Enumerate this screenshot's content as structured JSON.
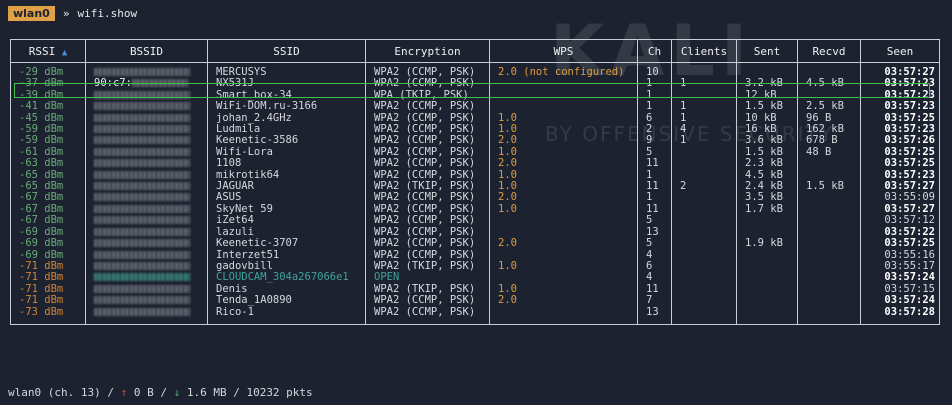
{
  "header": {
    "interface_tag": "wlan0",
    "prompt_symbol": "»",
    "command": "wifi.show"
  },
  "watermark": {
    "logo_text": "KALI",
    "subtitle": "BY OFFENSIVE SECURITY"
  },
  "columns": {
    "rssi": "RSSI",
    "bssid": "BSSID",
    "ssid": "SSID",
    "encryption": "Encryption",
    "wps": "WPS",
    "ch": "Ch",
    "clients": "Clients",
    "sent": "Sent",
    "recvd": "Recvd",
    "seen": "Seen"
  },
  "colors": {
    "background": "#1c2230",
    "rssi_good": "#6aaa78",
    "rssi_weak": "#d1843a",
    "wps_value": "#e09a3e",
    "open_network": "#3fa39a",
    "selection_outline": "#3fc24d",
    "interface_tag_bg": "#e0a047"
  },
  "rows": [
    {
      "rssi": "-29 dBm",
      "rssi_level": "good",
      "bssid_visible": "",
      "ssid": "MERCUSYS",
      "encryption": "WPA2 (CCMP, PSK)",
      "wps": "2.0 (not configured)",
      "ch": "10",
      "clients": "",
      "sent": "",
      "recvd": "",
      "seen": "03:57:27",
      "seen_bold": true
    },
    {
      "rssi": "-37 dBm",
      "rssi_level": "good",
      "bssid_visible": "90:c7:",
      "ssid": "NX531J",
      "encryption": "WPA2 (CCMP, PSK)",
      "wps": "",
      "ch": "1",
      "clients": "1",
      "sent": "3.2 kB",
      "recvd": "4.5 kB",
      "seen": "03:57:23",
      "seen_bold": true,
      "selected": true
    },
    {
      "rssi": "-39 dBm",
      "rssi_level": "good",
      "bssid_visible": "",
      "ssid": "Smart_box-34",
      "encryption": "WPA (TKIP, PSK)",
      "wps": "",
      "ch": "1",
      "clients": "",
      "sent": "12 kB",
      "recvd": "",
      "seen": "03:57:23",
      "seen_bold": true
    },
    {
      "rssi": "-41 dBm",
      "rssi_level": "good",
      "bssid_visible": "",
      "ssid": "WiFi-DOM.ru-3166",
      "encryption": "WPA2 (CCMP, PSK)",
      "wps": "",
      "ch": "1",
      "clients": "1",
      "sent": "1.5 kB",
      "recvd": "2.5 kB",
      "seen": "03:57:23",
      "seen_bold": true
    },
    {
      "rssi": "-45 dBm",
      "rssi_level": "good",
      "bssid_visible": "",
      "ssid": "johan_2.4GHz",
      "encryption": "WPA2 (CCMP, PSK)",
      "wps": "1.0",
      "ch": "6",
      "clients": "1",
      "sent": "10 kB",
      "recvd": "96 B",
      "seen": "03:57:25",
      "seen_bold": true
    },
    {
      "rssi": "-59 dBm",
      "rssi_level": "good",
      "bssid_visible": "",
      "ssid": "Ludmila",
      "encryption": "WPA2 (CCMP, PSK)",
      "wps": "1.0",
      "ch": "2",
      "clients": "4",
      "sent": "16 kB",
      "recvd": "162 kB",
      "seen": "03:57:23",
      "seen_bold": true
    },
    {
      "rssi": "-59 dBm",
      "rssi_level": "good",
      "bssid_visible": "",
      "ssid": "Keenetic-3586",
      "encryption": "WPA2 (CCMP, PSK)",
      "wps": "2.0",
      "ch": "9",
      "clients": "1",
      "sent": "3.6 kB",
      "recvd": "678 B",
      "seen": "03:57:26",
      "seen_bold": true
    },
    {
      "rssi": "-61 dBm",
      "rssi_level": "good",
      "bssid_visible": "",
      "ssid": "Wifi-Lora",
      "encryption": "WPA2 (CCMP, PSK)",
      "wps": "1.0",
      "ch": "5",
      "clients": "",
      "sent": "1.5 kB",
      "recvd": "48 B",
      "seen": "03:57:25",
      "seen_bold": true
    },
    {
      "rssi": "-63 dBm",
      "rssi_level": "good",
      "bssid_visible": "",
      "ssid": "1108",
      "encryption": "WPA2 (CCMP, PSK)",
      "wps": "2.0",
      "ch": "11",
      "clients": "",
      "sent": "2.3 kB",
      "recvd": "",
      "seen": "03:57:25",
      "seen_bold": true
    },
    {
      "rssi": "-65 dBm",
      "rssi_level": "good",
      "bssid_visible": "",
      "ssid": "mikrotik64",
      "encryption": "WPA2 (CCMP, PSK)",
      "wps": "1.0",
      "ch": "1",
      "clients": "",
      "sent": "4.5 kB",
      "recvd": "",
      "seen": "03:57:23",
      "seen_bold": true
    },
    {
      "rssi": "-65 dBm",
      "rssi_level": "good",
      "bssid_visible": "",
      "ssid": "JAGUAR",
      "encryption": "WPA2 (TKIP, PSK)",
      "wps": "1.0",
      "ch": "11",
      "clients": "2",
      "sent": "2.4 kB",
      "recvd": "1.5 kB",
      "seen": "03:57:27",
      "seen_bold": true
    },
    {
      "rssi": "-67 dBm",
      "rssi_level": "good",
      "bssid_visible": "",
      "ssid": "ASUS",
      "encryption": "WPA2 (CCMP, PSK)",
      "wps": "2.0",
      "ch": "1",
      "clients": "",
      "sent": "3.5 kB",
      "recvd": "",
      "seen": "03:55:09",
      "seen_bold": false
    },
    {
      "rssi": "-67 dBm",
      "rssi_level": "good",
      "bssid_visible": "",
      "ssid": "SkyNet 59",
      "encryption": "WPA2 (CCMP, PSK)",
      "wps": "1.0",
      "ch": "11",
      "clients": "",
      "sent": "1.7 kB",
      "recvd": "",
      "seen": "03:57:27",
      "seen_bold": true
    },
    {
      "rssi": "-67 dBm",
      "rssi_level": "good",
      "bssid_visible": "",
      "ssid": "iZet64",
      "encryption": "WPA2 (CCMP, PSK)",
      "wps": "",
      "ch": "5",
      "clients": "",
      "sent": "",
      "recvd": "",
      "seen": "03:57:12",
      "seen_bold": false
    },
    {
      "rssi": "-69 dBm",
      "rssi_level": "good",
      "bssid_visible": "",
      "ssid": "lazuli",
      "encryption": "WPA2 (CCMP, PSK)",
      "wps": "",
      "ch": "13",
      "clients": "",
      "sent": "",
      "recvd": "",
      "seen": "03:57:22",
      "seen_bold": true
    },
    {
      "rssi": "-69 dBm",
      "rssi_level": "good",
      "bssid_visible": "",
      "ssid": "Keenetic-3707",
      "encryption": "WPA2 (CCMP, PSK)",
      "wps": "2.0",
      "ch": "5",
      "clients": "",
      "sent": "1.9 kB",
      "recvd": "",
      "seen": "03:57:25",
      "seen_bold": true
    },
    {
      "rssi": "-69 dBm",
      "rssi_level": "good",
      "bssid_visible": "",
      "ssid": "Interzet51",
      "encryption": "WPA2 (CCMP, PSK)",
      "wps": "",
      "ch": "4",
      "clients": "",
      "sent": "",
      "recvd": "",
      "seen": "03:55:16",
      "seen_bold": false
    },
    {
      "rssi": "-71 dBm",
      "rssi_level": "weak",
      "bssid_visible": "",
      "ssid": "gadovbill",
      "encryption": "WPA2 (TKIP, PSK)",
      "wps": "1.0",
      "ch": "6",
      "clients": "",
      "sent": "",
      "recvd": "",
      "seen": "03:55:17",
      "seen_bold": false
    },
    {
      "rssi": "-71 dBm",
      "rssi_level": "weak",
      "bssid_visible": "",
      "ssid": "CLOUDCAM_304a267066e1",
      "encryption": "OPEN",
      "wps": "",
      "ch": "4",
      "clients": "",
      "sent": "",
      "recvd": "",
      "seen": "03:57:24",
      "seen_bold": true,
      "open": true
    },
    {
      "rssi": "-71 dBm",
      "rssi_level": "weak",
      "bssid_visible": "",
      "ssid": "Denis",
      "encryption": "WPA2 (TKIP, PSK)",
      "wps": "1.0",
      "ch": "11",
      "clients": "",
      "sent": "",
      "recvd": "",
      "seen": "03:57:15",
      "seen_bold": false
    },
    {
      "rssi": "-71 dBm",
      "rssi_level": "weak",
      "bssid_visible": "",
      "ssid": "Tenda_1A0890",
      "encryption": "WPA2 (CCMP, PSK)",
      "wps": "2.0",
      "ch": "7",
      "clients": "",
      "sent": "",
      "recvd": "",
      "seen": "03:57:24",
      "seen_bold": true
    },
    {
      "rssi": "-73 dBm",
      "rssi_level": "weak",
      "bssid_visible": "",
      "ssid": "Rico-1",
      "encryption": "WPA2 (CCMP, PSK)",
      "wps": "",
      "ch": "13",
      "clients": "",
      "sent": "",
      "recvd": "",
      "seen": "03:57:28",
      "seen_bold": true
    }
  ],
  "status": {
    "prefix": "wlan0 (ch. 13) /",
    "up_arrow": "↑",
    "up_value": "0 B /",
    "down_arrow": "↓",
    "down_value": "1.6 MB / 10232 pkts"
  }
}
